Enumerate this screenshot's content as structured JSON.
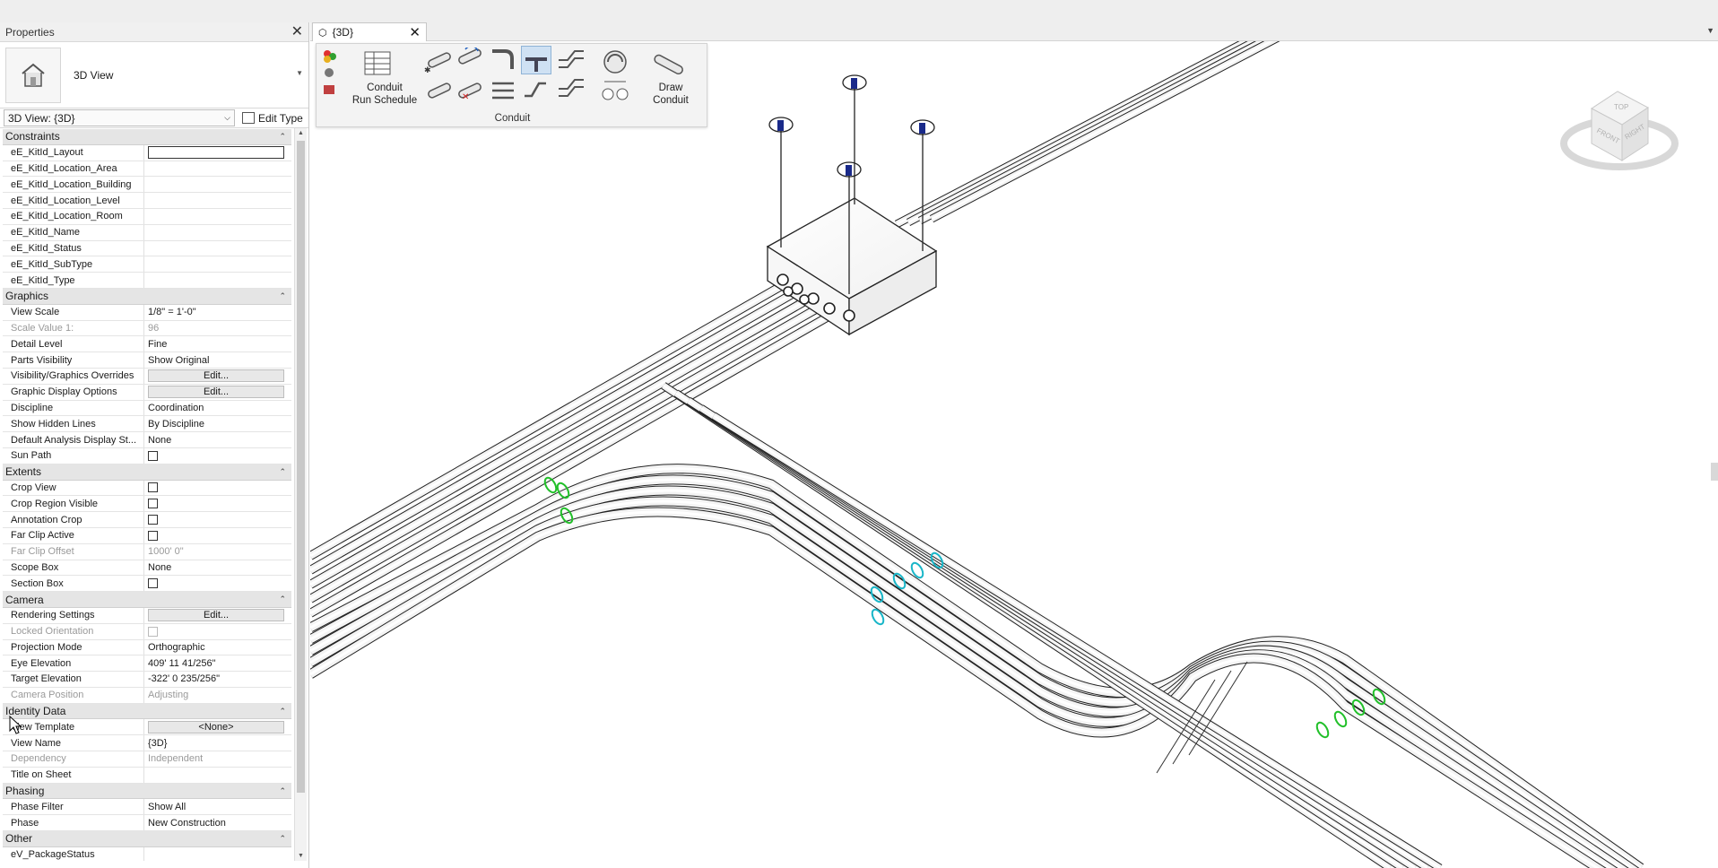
{
  "properties_panel": {
    "title": "Properties",
    "type_selector_label": "3D View",
    "instance_selector": "3D View: {3D}",
    "edit_type_label": "Edit Type",
    "groups": [
      {
        "name": "Constraints",
        "rows": [
          {
            "name": "eE_KitId_Layout",
            "value": "",
            "kind": "box"
          },
          {
            "name": "eE_KitId_Location_Area",
            "value": ""
          },
          {
            "name": "eE_KitId_Location_Building",
            "value": ""
          },
          {
            "name": "eE_KitId_Location_Level",
            "value": ""
          },
          {
            "name": "eE_KitId_Location_Room",
            "value": ""
          },
          {
            "name": "eE_KitId_Name",
            "value": ""
          },
          {
            "name": "eE_KitId_Status",
            "value": ""
          },
          {
            "name": "eE_KitId_SubType",
            "value": ""
          },
          {
            "name": "eE_KitId_Type",
            "value": ""
          }
        ]
      },
      {
        "name": "Graphics",
        "rows": [
          {
            "name": "View Scale",
            "value": "1/8\" = 1'-0\""
          },
          {
            "name": "Scale Value    1:",
            "value": "96",
            "disabled": true
          },
          {
            "name": "Detail Level",
            "value": "Fine"
          },
          {
            "name": "Parts Visibility",
            "value": "Show Original"
          },
          {
            "name": "Visibility/Graphics Overrides",
            "value": "Edit...",
            "kind": "button"
          },
          {
            "name": "Graphic Display Options",
            "value": "Edit...",
            "kind": "button"
          },
          {
            "name": "Discipline",
            "value": "Coordination"
          },
          {
            "name": "Show Hidden Lines",
            "value": "By Discipline"
          },
          {
            "name": "Default Analysis Display St...",
            "value": "None"
          },
          {
            "name": "Sun Path",
            "value": "",
            "kind": "checkbox"
          }
        ]
      },
      {
        "name": "Extents",
        "rows": [
          {
            "name": "Crop View",
            "value": "",
            "kind": "checkbox"
          },
          {
            "name": "Crop Region Visible",
            "value": "",
            "kind": "checkbox"
          },
          {
            "name": "Annotation Crop",
            "value": "",
            "kind": "checkbox"
          },
          {
            "name": "Far Clip Active",
            "value": "",
            "kind": "checkbox"
          },
          {
            "name": "Far Clip Offset",
            "value": "1000'  0\"",
            "disabled": true
          },
          {
            "name": "Scope Box",
            "value": "None"
          },
          {
            "name": "Section Box",
            "value": "",
            "kind": "checkbox"
          }
        ]
      },
      {
        "name": "Camera",
        "rows": [
          {
            "name": "Rendering Settings",
            "value": "Edit...",
            "kind": "button"
          },
          {
            "name": "Locked Orientation",
            "value": "",
            "kind": "checkbox",
            "disabled": true
          },
          {
            "name": "Projection Mode",
            "value": "Orthographic"
          },
          {
            "name": "Eye Elevation",
            "value": "409'  11 41/256\""
          },
          {
            "name": "Target Elevation",
            "value": "-322'  0 235/256\""
          },
          {
            "name": "Camera Position",
            "value": "Adjusting",
            "disabled": true
          }
        ]
      },
      {
        "name": "Identity Data",
        "rows": [
          {
            "name": "View Template",
            "value": "<None>",
            "kind": "button"
          },
          {
            "name": "View Name",
            "value": "{3D}"
          },
          {
            "name": "Dependency",
            "value": "Independent",
            "disabled": true
          },
          {
            "name": "Title on Sheet",
            "value": ""
          }
        ]
      },
      {
        "name": "Phasing",
        "rows": [
          {
            "name": "Phase Filter",
            "value": "Show All"
          },
          {
            "name": "Phase",
            "value": "New Construction"
          }
        ]
      },
      {
        "name": "Other",
        "rows": [
          {
            "name": "eV_PackageStatus",
            "value": ""
          }
        ]
      }
    ]
  },
  "view_tab": {
    "label": "{3D}"
  },
  "ribbon": {
    "conduit_run_schedule": "Conduit\nRun Schedule",
    "draw_conduit": "Draw\nConduit",
    "panel_label": "Conduit"
  },
  "viewcube": {
    "top": "TOP",
    "front": "FRONT",
    "right": "RIGHT"
  },
  "colors": {
    "accent_green": "#22c02a",
    "accent_cyan": "#19b6c8",
    "hanger_blue": "#1a2a8a"
  }
}
